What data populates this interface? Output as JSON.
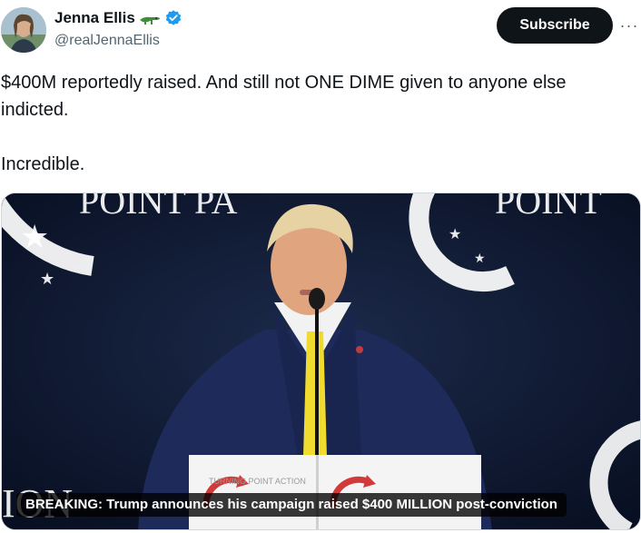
{
  "author": {
    "display_name": "Jenna Ellis",
    "handle": "@realJennaEllis",
    "emoji_icon": "crocodile-icon",
    "verified_icon": "verified-badge-icon",
    "verified_color": "#1d9bf0"
  },
  "actions": {
    "subscribe_label": "Subscribe",
    "more_label": "···"
  },
  "tweet": {
    "line1": "$400M reportedly raised. And still not ONE DIME given to anyone else indicted.",
    "line2": "Incredible."
  },
  "media": {
    "caption": "BREAKING: Trump announces his campaign raised $400 MILLION post-conviction",
    "backdrop_text_left": "POINT PA",
    "backdrop_text_right": "POINT",
    "backdrop_text_bottom": "ION",
    "podium_text": "TURNING POINT ACTION"
  },
  "colors": {
    "text_primary": "#0f1419",
    "text_secondary": "#536471",
    "button_bg": "#0f1419",
    "button_text": "#ffffff"
  }
}
